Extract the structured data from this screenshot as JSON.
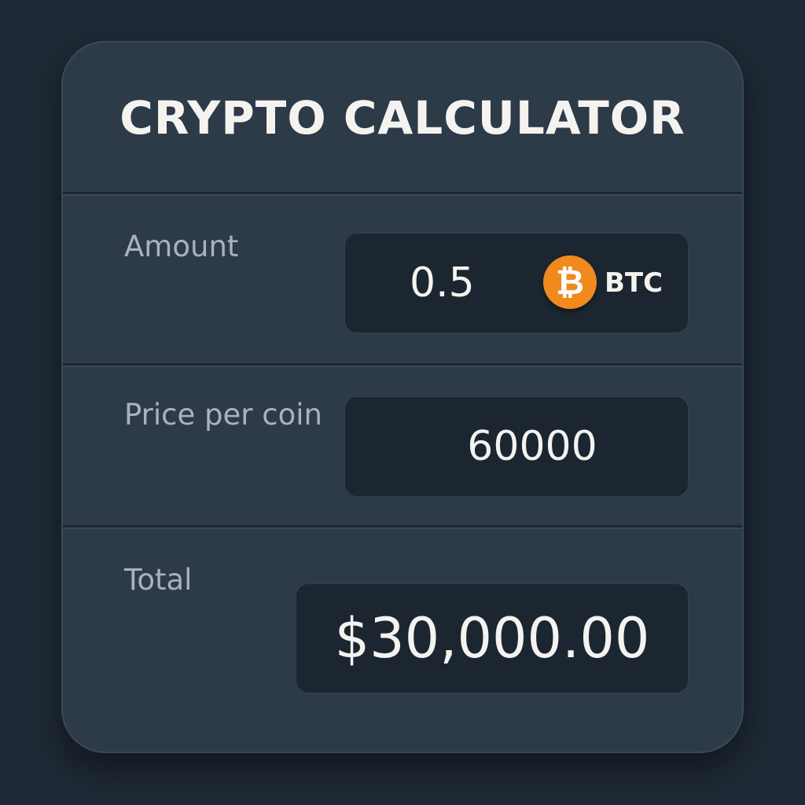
{
  "title": "CRYPTO CALCULATOR",
  "amount": {
    "label": "Amount",
    "value": "0.5",
    "currency_symbol": "₿",
    "currency": "BTC",
    "currency_icon": "bitcoin-icon",
    "currency_color": "#f08a1e"
  },
  "price": {
    "label": "Price per coin",
    "value": "60000"
  },
  "total": {
    "label": "Total",
    "value": "$30,000.00"
  }
}
